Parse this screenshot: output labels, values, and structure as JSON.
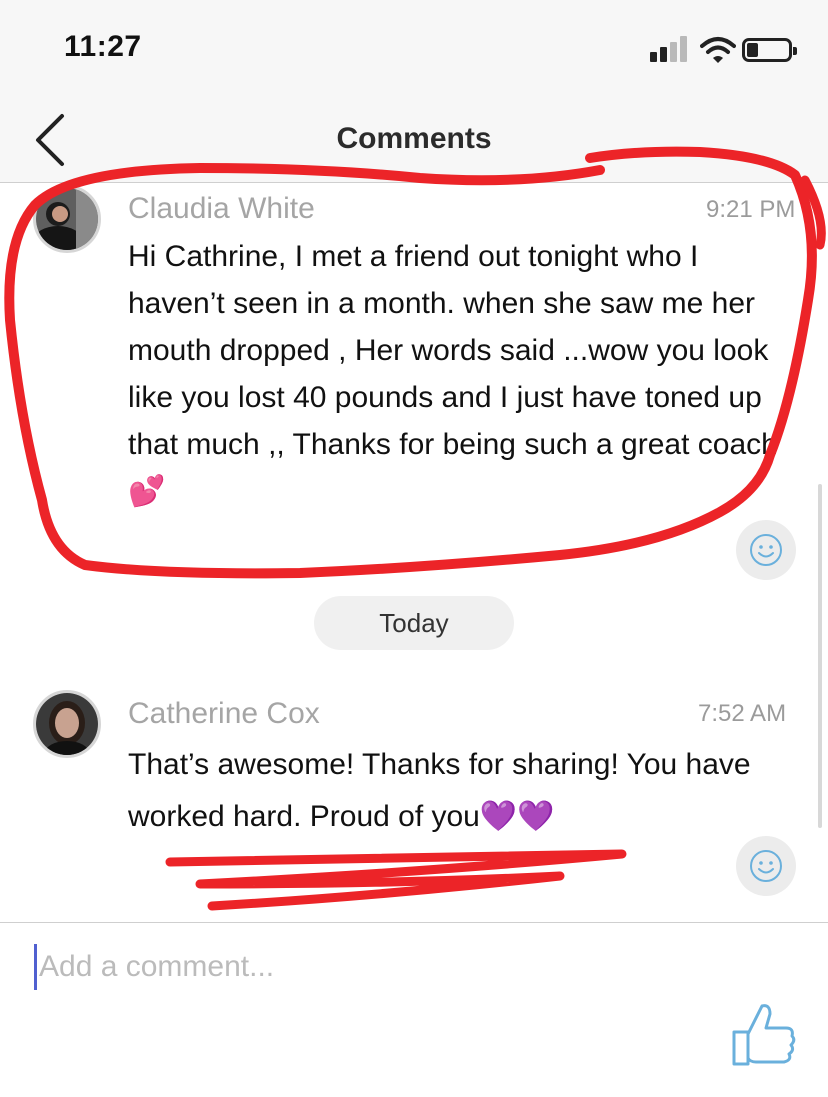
{
  "status_bar": {
    "time": "11:27"
  },
  "header": {
    "title": "Comments"
  },
  "comments": [
    {
      "author": "Claudia White",
      "time": "9:21 PM",
      "text": "Hi Cathrine, I met a friend out tonight who I haven’t seen in a month. when she saw me her mouth dropped , Her words said ...wow you look like you lost 40 pounds and I just have toned up that much ,, Thanks for being such a great coach 💕"
    },
    {
      "author": "Catherine Cox",
      "time": "7:52 AM",
      "text": "That’s awesome! Thanks for sharing! You have worked hard. Proud of you💜💜"
    }
  ],
  "date_separator": "Today",
  "composer": {
    "placeholder": "Add a comment..."
  },
  "icons": {
    "back": "chevron-left-icon",
    "react": "smiley-icon",
    "like": "thumbs-up-icon",
    "signal": "cellular-signal-icon",
    "wifi": "wifi-icon",
    "battery": "battery-icon"
  },
  "colors": {
    "annotation": "#ec2428",
    "icon_blue": "#6ab0dc",
    "caret": "#5060d0"
  }
}
